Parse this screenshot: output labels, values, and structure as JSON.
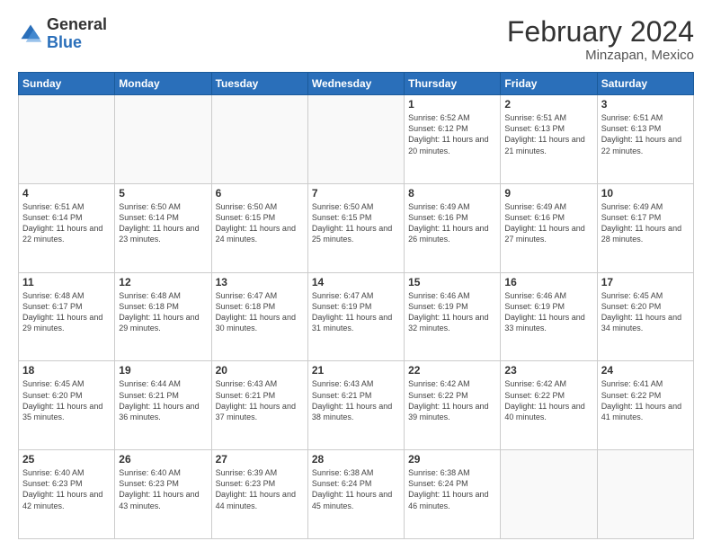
{
  "header": {
    "logo_general": "General",
    "logo_blue": "Blue",
    "title": "February 2024",
    "subtitle": "Minzapan, Mexico"
  },
  "days_of_week": [
    "Sunday",
    "Monday",
    "Tuesday",
    "Wednesday",
    "Thursday",
    "Friday",
    "Saturday"
  ],
  "weeks": [
    [
      {
        "day": "",
        "info": ""
      },
      {
        "day": "",
        "info": ""
      },
      {
        "day": "",
        "info": ""
      },
      {
        "day": "",
        "info": ""
      },
      {
        "day": "1",
        "info": "Sunrise: 6:52 AM\nSunset: 6:12 PM\nDaylight: 11 hours and 20 minutes."
      },
      {
        "day": "2",
        "info": "Sunrise: 6:51 AM\nSunset: 6:13 PM\nDaylight: 11 hours and 21 minutes."
      },
      {
        "day": "3",
        "info": "Sunrise: 6:51 AM\nSunset: 6:13 PM\nDaylight: 11 hours and 22 minutes."
      }
    ],
    [
      {
        "day": "4",
        "info": "Sunrise: 6:51 AM\nSunset: 6:14 PM\nDaylight: 11 hours and 22 minutes."
      },
      {
        "day": "5",
        "info": "Sunrise: 6:50 AM\nSunset: 6:14 PM\nDaylight: 11 hours and 23 minutes."
      },
      {
        "day": "6",
        "info": "Sunrise: 6:50 AM\nSunset: 6:15 PM\nDaylight: 11 hours and 24 minutes."
      },
      {
        "day": "7",
        "info": "Sunrise: 6:50 AM\nSunset: 6:15 PM\nDaylight: 11 hours and 25 minutes."
      },
      {
        "day": "8",
        "info": "Sunrise: 6:49 AM\nSunset: 6:16 PM\nDaylight: 11 hours and 26 minutes."
      },
      {
        "day": "9",
        "info": "Sunrise: 6:49 AM\nSunset: 6:16 PM\nDaylight: 11 hours and 27 minutes."
      },
      {
        "day": "10",
        "info": "Sunrise: 6:49 AM\nSunset: 6:17 PM\nDaylight: 11 hours and 28 minutes."
      }
    ],
    [
      {
        "day": "11",
        "info": "Sunrise: 6:48 AM\nSunset: 6:17 PM\nDaylight: 11 hours and 29 minutes."
      },
      {
        "day": "12",
        "info": "Sunrise: 6:48 AM\nSunset: 6:18 PM\nDaylight: 11 hours and 29 minutes."
      },
      {
        "day": "13",
        "info": "Sunrise: 6:47 AM\nSunset: 6:18 PM\nDaylight: 11 hours and 30 minutes."
      },
      {
        "day": "14",
        "info": "Sunrise: 6:47 AM\nSunset: 6:19 PM\nDaylight: 11 hours and 31 minutes."
      },
      {
        "day": "15",
        "info": "Sunrise: 6:46 AM\nSunset: 6:19 PM\nDaylight: 11 hours and 32 minutes."
      },
      {
        "day": "16",
        "info": "Sunrise: 6:46 AM\nSunset: 6:19 PM\nDaylight: 11 hours and 33 minutes."
      },
      {
        "day": "17",
        "info": "Sunrise: 6:45 AM\nSunset: 6:20 PM\nDaylight: 11 hours and 34 minutes."
      }
    ],
    [
      {
        "day": "18",
        "info": "Sunrise: 6:45 AM\nSunset: 6:20 PM\nDaylight: 11 hours and 35 minutes."
      },
      {
        "day": "19",
        "info": "Sunrise: 6:44 AM\nSunset: 6:21 PM\nDaylight: 11 hours and 36 minutes."
      },
      {
        "day": "20",
        "info": "Sunrise: 6:43 AM\nSunset: 6:21 PM\nDaylight: 11 hours and 37 minutes."
      },
      {
        "day": "21",
        "info": "Sunrise: 6:43 AM\nSunset: 6:21 PM\nDaylight: 11 hours and 38 minutes."
      },
      {
        "day": "22",
        "info": "Sunrise: 6:42 AM\nSunset: 6:22 PM\nDaylight: 11 hours and 39 minutes."
      },
      {
        "day": "23",
        "info": "Sunrise: 6:42 AM\nSunset: 6:22 PM\nDaylight: 11 hours and 40 minutes."
      },
      {
        "day": "24",
        "info": "Sunrise: 6:41 AM\nSunset: 6:22 PM\nDaylight: 11 hours and 41 minutes."
      }
    ],
    [
      {
        "day": "25",
        "info": "Sunrise: 6:40 AM\nSunset: 6:23 PM\nDaylight: 11 hours and 42 minutes."
      },
      {
        "day": "26",
        "info": "Sunrise: 6:40 AM\nSunset: 6:23 PM\nDaylight: 11 hours and 43 minutes."
      },
      {
        "day": "27",
        "info": "Sunrise: 6:39 AM\nSunset: 6:23 PM\nDaylight: 11 hours and 44 minutes."
      },
      {
        "day": "28",
        "info": "Sunrise: 6:38 AM\nSunset: 6:24 PM\nDaylight: 11 hours and 45 minutes."
      },
      {
        "day": "29",
        "info": "Sunrise: 6:38 AM\nSunset: 6:24 PM\nDaylight: 11 hours and 46 minutes."
      },
      {
        "day": "",
        "info": ""
      },
      {
        "day": "",
        "info": ""
      }
    ]
  ]
}
